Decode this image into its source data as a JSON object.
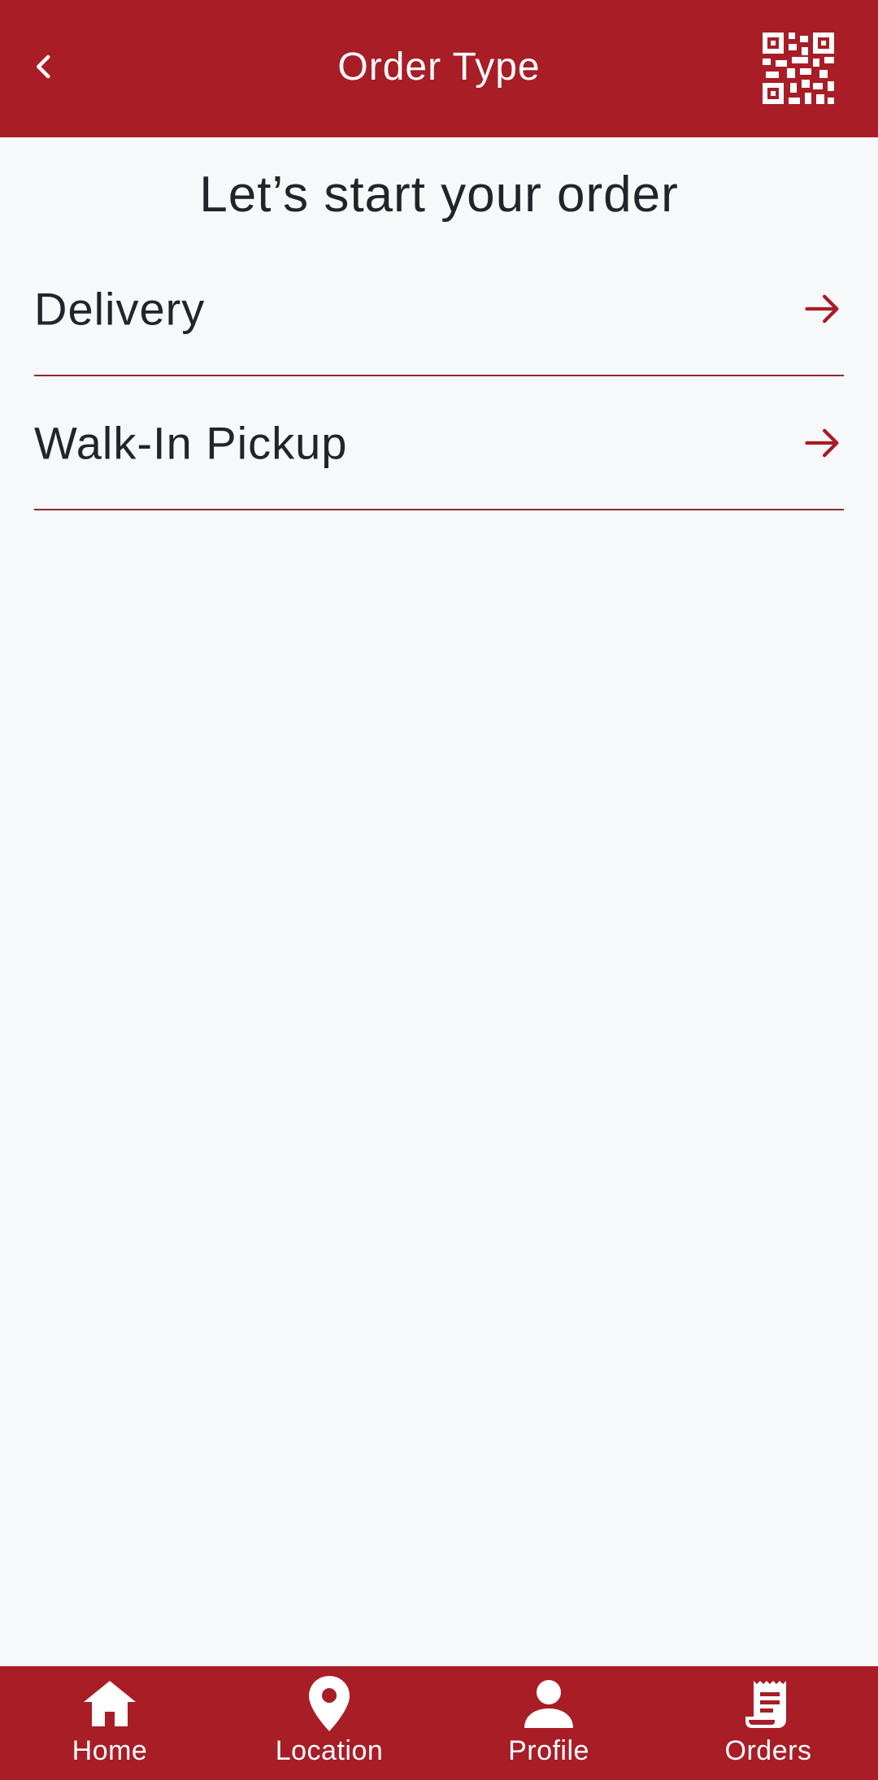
{
  "header": {
    "title": "Order Type",
    "back_icon": "chevron-left-icon",
    "qr_icon": "qr-code-icon"
  },
  "main": {
    "heading": "Let’s start your order",
    "options": [
      {
        "label": "Delivery",
        "icon": "arrow-right-icon"
      },
      {
        "label": "Walk-In Pickup",
        "icon": "arrow-right-icon"
      }
    ]
  },
  "bottom_nav": {
    "items": [
      {
        "label": "Home",
        "icon": "home-icon"
      },
      {
        "label": "Location",
        "icon": "location-pin-icon"
      },
      {
        "label": "Profile",
        "icon": "person-icon"
      },
      {
        "label": "Orders",
        "icon": "receipt-icon"
      }
    ]
  },
  "colors": {
    "brand": "#a81d26",
    "background": "#f7f8fa",
    "text": "#23232a",
    "divider": "#8e2a2f"
  }
}
